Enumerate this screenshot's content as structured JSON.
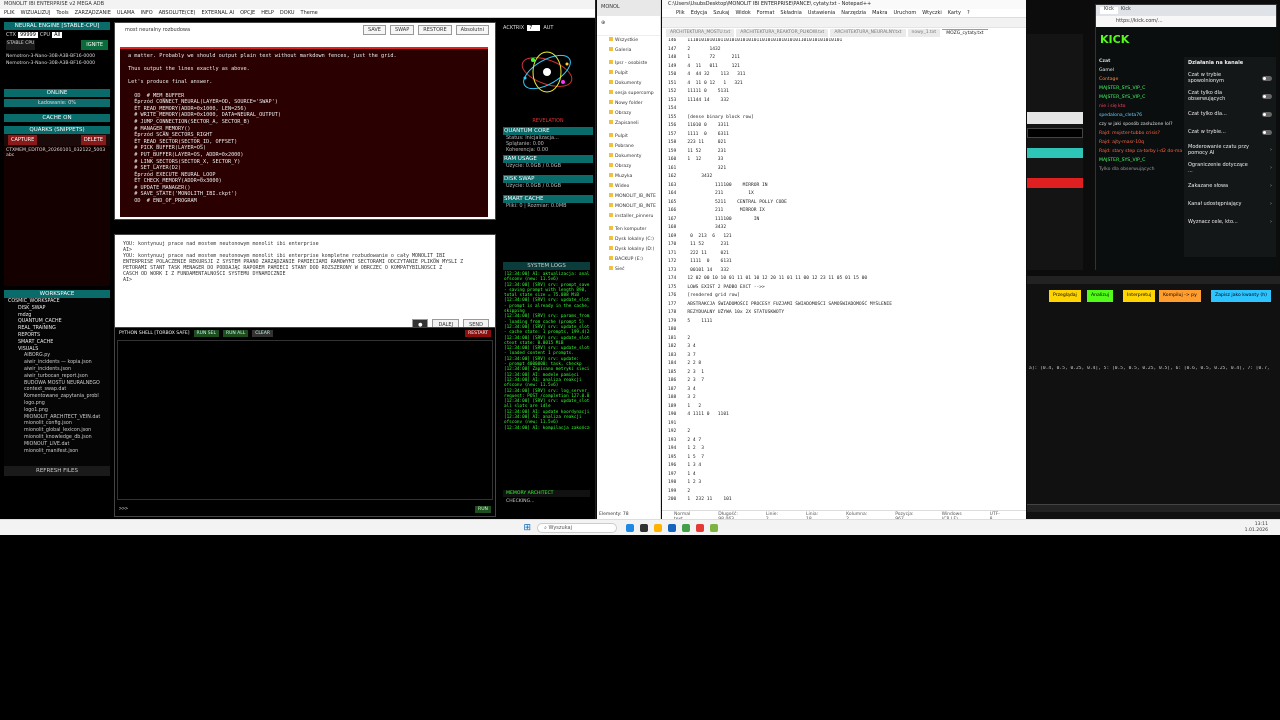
{
  "app1": {
    "title": "MONOLIT IBI ENTERPRISE v2 MEGA ADB",
    "menu": [
      "PLIK",
      "WIZUALIZUJ",
      "Tools",
      "ZARZĄDZANIE",
      "ULAMA",
      "INFO",
      "ABSOLUTE(CE)",
      "EXTERNAL AI",
      "OPCJE",
      "HELP",
      "DOKU",
      "Theme"
    ]
  },
  "left": {
    "neural_title": "NEURAL ENGINE [STABLE-CPU]",
    "ctx_label": "CTX",
    "ctx_value": "99999",
    "cpu_label": "CPU",
    "gpu_label": "All",
    "stable": "STABLE CPU",
    "ignite": "IGNITE",
    "models": [
      "Nemotron-3-Nano-30B-A3B-BF16-0000",
      "Nemotron-3-Nano-30B-A3B-BF16-0000"
    ],
    "online": "ONLINE",
    "loading": "Ładowanie: 0%",
    "cache": "CACHE ON",
    "quarks_title": "QUARKS (SNIPPETS)",
    "capture": "CAPTURE",
    "delete": "DELETE",
    "snippet": "CTXMEM_EDITOR_20260101_032122_5003",
    "snippet2": "abc",
    "workspace_title": "WORKSPACE",
    "files": [
      "COSMIC_WORKSPACE",
      "DISK_SWAP",
      "mdzg",
      "QUANTUM_CACHE",
      "REAL_TRAINING",
      "REPORTS",
      "SMART_CACHE",
      "VISUALS",
      "AIBORG.py",
      "aiwir_incidents — kopia.json",
      "aiwir_incidents.json",
      "aiwir_turbocan_report.json",
      "BUDOWA MOSTU NEURALNEGO",
      "context_swap.dat",
      "Komentowane_zapytania_probl",
      "logo.png",
      "logo1.png",
      "MIONOLIT_ARCHITECT_VEIN.dat",
      "mionolit_config.json",
      "mionolit_global_lexicon.json",
      "mionolit_knowledge_db.json",
      "MIONOUT_LIVE.dat",
      "mionolit_manifest.json"
    ],
    "refresh": "REFRESH FILES"
  },
  "editor": {
    "filename": "most neuralny rozbudowa",
    "buttons": [
      "SAVE",
      "SWAP",
      "RESTORE",
      "Absolutni"
    ],
    "lines": [
      "a matter. Probably we should output plain text without markdown fences, just the grid.",
      "",
      "Thus output the lines exactly as above.",
      "",
      "Let's produce final answer.",
      "",
      "  OD  # MEM_BUFFER",
      "  Éprzód CONNECT_NEURAL(LAYER=OD, SOURCE='SWAP')",
      "  ÉT READ_MEMORY(ADDR=0x1000, LEN=256)",
      "  # WRITE_MEMORY(ADDR=0x1000, DATA=NEURAL_OUTPUT)",
      "  # JUMP_CONNECTION(SECTOR_A, SECTOR_B)",
      "  # MANAGER_MEMORY()",
      "  Éprzód SCAN_SECTORS_RIGHT",
      "  ÉT READ_SECTOR(SECTOR_ID, OFFSET)",
      "  # PICK_BUFFER(LAYER=OS)",
      "  # PUT_BUFFER(LAYER=OS, ADDR=0x2000)",
      "  # LINK_SECTORS(SECTOR_X, SECTOR_Y)",
      "  # SET_LAYER(D2)",
      "  Éprzód EXECUTE_NEURAL_LOOP",
      "  ÉT CHECK_MEMORY(ADDR=0x3000)",
      "  # UPDATE_MANAGER()",
      "  # SAVE_STATE('MONOLITH_IBI.ckpt')",
      "  OD  # END_OF_PROGRAM"
    ]
  },
  "chat": {
    "lines": [
      "YOU: kontynuuj prace nad mostem neutonowym monolit ibi enterprise",
      "AI>",
      "YOU: kontynuuj prace nad mostem neutonowym monolit ibi enterprise kompletne rozbudowanie o cały MONOLIT_IBI",
      "ENTERPRISE POLACZENIE REKURSJI Z SYSTEM PRANO ZARZĄDZANIE PAMIECIAMI RAMOWYMI SECTORAMI ODCZYTANIE PLIKOW MYSLI Z",
      "PETORAMI STANT TASK MENAGER DO PODDAJĄC RAPOREM PAMIECI STANY DOD ROZSZERONY W OBRCZEC O KOMPATYBILNOSCI Z",
      "CASCH OD WORK I Z FUNDAMENTALNOŚCI SYSTEMU DYNAMICZNIE",
      "AI>"
    ],
    "buttons": [
      "DALEJ",
      "SEND"
    ]
  },
  "shell": {
    "title": "PYTHON SHELL [TORBOX SAFE]",
    "buttons": [
      "RUN SEL",
      "RUN ALL",
      "CLEAR"
    ],
    "restart": "RESTART",
    "prompt": ">>>",
    "run": "RUN"
  },
  "right": {
    "actrix": "ACKTRIX",
    "actrix_val": "7",
    "auto": "AUT",
    "revelation": "REVELATION",
    "qcore_title": "QUANTUM CORE",
    "qcore": [
      "Status: Inicjalizacja...",
      "Splątanie: 0.00",
      "Koherencja: 0.00"
    ],
    "ram_title": "RAM USAGE",
    "ram": "Użycie: 0.0GB / 0.0GB",
    "swap_title": "DISK SWAP",
    "swap": "Użycie: 0.0GB / 0.0GB",
    "smart_title": "SMART CACHE",
    "smart": "Pliki: 0 | Rozmiar: 0.0MB",
    "syslog_title": "SYSTEM LOGS",
    "log": [
      "[12:34:00] AI: aktualizacja: analiza reakcji",
      "ofsconv (new: 11.5v6)",
      "[12:34:00] [SRV] srv: prompt_save:",
      "- saving prompt with length 890,",
      "total state size = 75.088 MiB",
      "[12:34:00] [SRV] srv: update_slots:",
      "- prompt is already in the cache,",
      "skipping",
      "[12:34:00] [SRV] srv: params_from_:",
      "- loading from cache (prompt 5)",
      "[12:34:00] [SRV] srv: update_slots:",
      "- cache state: 1 prompts, 199.4(2)",
      "[12:34:00] [SRV] srv: update_slots:",
      "ctext state: 0.0015 MiB",
      "[12:34:00] [SRV] srv: update_slots:",
      "- loaded content 1 prompts.",
      "[12:34:00] [SRV] srv: update:",
      "- prompt 4000000: task, checkp",
      "[12:34:00] Zapisano metryki sieci",
      "[12:34:00] AI: modele pamięci",
      "[12:34:00] AI: analiza reakcji",
      "ofsconv (new: 11.5v6)",
      "[12:34:00] [SRV] srv: log_server_r",
      "request: POST /completion 127.0.0.1",
      "[12:34:00] [SRV] srv: update_slots:",
      "all slots are idle",
      "[12:34:00] AI: update koordynacji",
      "[12:34:00] AI: analiza reakcji",
      "ofsconv (new: 11.5v6)",
      "[12:34:00] AI: kompilacja zakończona"
    ],
    "memarch": "MEMORY ARCHITECT",
    "checking": "CHECKING..."
  },
  "explorer": {
    "tab": "MONOL",
    "items": [
      "Wszystkie",
      "Galeria",
      "Ipsr - osobiste",
      "Pulpit",
      "Dokumenty",
      "sesja supercomp",
      "Nowy folder",
      "Obrazy",
      "Zapisaneli",
      "Pulpit",
      "Pobrane",
      "Dokumenty",
      "Obrazy",
      "Muzyka",
      "Wideo",
      "MONOLIT_IB_INTE",
      "MONOLIT_IB_INTE",
      "installer_pinneru",
      "Ten komputer",
      "Dysk lokalny (C:)",
      "Dysk lokalny (D:)",
      "BACKUP (E:)",
      "Sieć"
    ],
    "status": "Elementy: 78"
  },
  "notepad": {
    "title": "C:\\Users\\UsubsDesktop\\MONOLIT IBI ENTERPRISE\\PANCE\\ cytaty.txt - Notepad++",
    "menu": [
      "Plik",
      "Edycja",
      "Szukaj",
      "Widok",
      "Format",
      "Składnia",
      "Ustawienia",
      "Narzędzia",
      "Makra",
      "Uruchom",
      "Wtyczki",
      "Karty",
      "?"
    ],
    "tabs": [
      "ARCHITEKTURA_MOSTU.txt",
      "ARCHITEKTURA_REAKTOR_PLIKOW.txt",
      "ARCHITEKTURA_NEURALNY.txt",
      "nowy_1.txt",
      "MOZG_cytaty.txt"
    ],
    "lines": [
      "146    11101010101011010101010101101010101010101101010101010101",
      "147    2       1432",
      "148    1       72      211",
      "149    4  11   011     121",
      "150    4  44 32    113   311",
      "151    4  11 0 12   1   321",
      "152    11111 0    5131",
      "153    11144 14    332",
      "154",
      "155    [dense binary block row]",
      "156    11010 0    3311",
      "157    1111  0    6311",
      "158    223 11     021",
      "159    11 52      231",
      "160    1  12      33",
      "161               321",
      "162         3432",
      "163              111100    MIRROR IN",
      "164              211         1X",
      "165              5211    CENTRAL POLLY CODE",
      "166              211      MIRROR IX",
      "167              111100        IN",
      "168              3432",
      "169     0  213  6   121",
      "170     11 52      231",
      "171     222 11     021",
      "172     1111  0    6131",
      "173     00101 14   332",
      "174    12 02 00 10 10 01 11 01 10 12 20 11 01 11 00 12 23 11 05 01 15 00",
      "175    LOWS EXIST 2 PADBO EXCT -->>",
      "176    [rendered grid row]",
      "177    ABSTRAKCJA ŚWIADOMOŚCI PROCESY FUZJAMI ŚWIADOMOŚCI SAMOŚWIADOMOŚĆ MYŚLENIE",
      "178    REZYDUALNY UŻYWA 10x 2X STATUSKWOTY",
      "179    5    1111",
      "180",
      "181    2",
      "182    3 4",
      "183    3 7",
      "184    2 2 8",
      "185    2 3  1",
      "186    2 3  7",
      "187    3 4",
      "188    3 2",
      "189    1   2",
      "190    4 1111 0   1101",
      "191",
      "192    2",
      "193    2 4 7",
      "194    1 2  3",
      "195    1 5  7",
      "196    1 3 4",
      "197    1 4",
      "198    1 2 3",
      "199    2",
      "200    1  232 11    101"
    ],
    "status": [
      "Normal text file",
      "Długość: 98 063",
      "Linie: 2 721",
      "Linia: 18",
      "Kolumna: 2",
      "Pozycja: 967",
      "Windows (CR LF)",
      "UTF-8",
      "INS"
    ]
  },
  "browser": {
    "tabs": [
      "Kick",
      "Kick"
    ],
    "url": "https://kick.com/...",
    "chat_title": "Czat",
    "chat": [
      [
        "Gamel",
        "#f0f0f0",
        ""
      ],
      [
        "Contage",
        "#ff8844",
        "Contage"
      ],
      [
        "MAJSTER_SYS_VIP_C",
        "#44ff66",
        ""
      ],
      [
        "MAJSTER_SYS_VIP_C",
        "#44ff66",
        ""
      ],
      [
        "nie i się kto",
        "#ff4466",
        ""
      ],
      [
        "spedalona_cleta76",
        "#66ccff",
        ""
      ],
      [
        "czy w jaki sposób zasłużone lol?",
        "#dddddd",
        ""
      ],
      [
        "Rajd: mojster-tubbo crisis?",
        "#ff6644",
        ""
      ],
      [
        "Rajd: ajty-masr-10q",
        "#ff6644",
        ""
      ],
      [
        "Rajd: stary step ca-torby i-d2 do-maktdonald",
        "#ff6644",
        ""
      ],
      [
        "MAJSTER_SYS_VIP_C",
        "#44ff66",
        ""
      ],
      [
        "Tylko dla obserwujących",
        "#999999",
        ""
      ]
    ],
    "menu_title": "Działania na kanale",
    "menu": [
      "Czat w trybie spowolnionym",
      "Czat tylko dla obserwujących",
      "Czat tylko dla...",
      "Czat w trybie...",
      "Moderowanie czatu przy pomocy AI",
      "Ograniczenie dotyczące ...",
      "Zakazane słowa",
      "Kanał udostępniający",
      "Wyznacz cele, kto..."
    ],
    "brand": "KICK"
  },
  "preview": {
    "buttons": [
      "Przeglądaj",
      "Analizuj",
      "Interpretuj",
      "Kompiluj -> py",
      "Zapisz jako kwanty (h)"
    ],
    "code": "a]: [0.4, 0.5, 0.25, 0.4], 5: [0.5, 0.5, 0.25, 0.5], 6: [0.6, 0.5, 0.25, 0.4], 7: [0.7,"
  },
  "taskbar": {
    "search": "Wyszukaj",
    "time": "13:11",
    "date": "1.01.2026"
  },
  "colors": {
    "teal": "#0a6b6b",
    "red_panel": "#2a0000",
    "log_green": "#33ff33",
    "kick_green": "#53fc18"
  }
}
